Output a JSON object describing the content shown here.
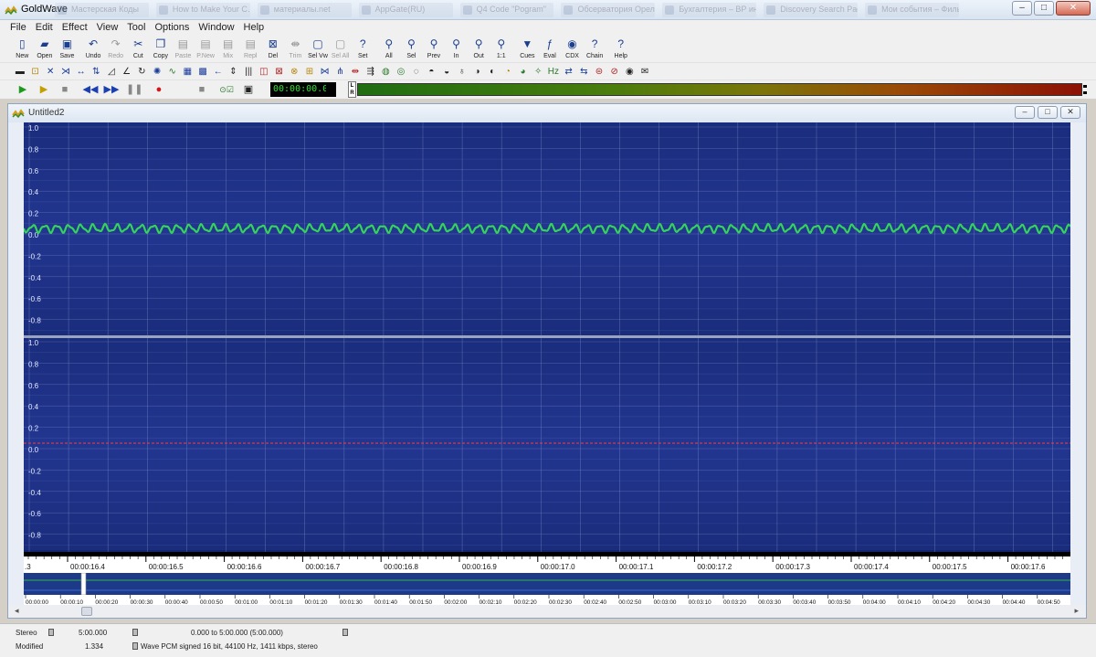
{
  "window": {
    "title": "GoldWave",
    "taskbar_ghosts": [
      "Мастерская Коды",
      "How to Make Your C…",
      "материалы.net",
      "AppGate(RU)",
      "Q4 Code \"Pogram\"",
      "Обсерватория Орел…",
      "Бухгалтерия – ВР инв…",
      "Discovery Search Page",
      "Мои события – Фильм…"
    ]
  },
  "menu": [
    "File",
    "Edit",
    "Effect",
    "View",
    "Tool",
    "Options",
    "Window",
    "Help"
  ],
  "toolbar": [
    {
      "label": "New",
      "icon": "new-file-icon",
      "glyph": "▯",
      "enabled": true
    },
    {
      "label": "Open",
      "icon": "folder-open-icon",
      "glyph": "▰",
      "enabled": true
    },
    {
      "label": "Save",
      "icon": "save-icon",
      "glyph": "▣",
      "enabled": true
    },
    {
      "sep": true
    },
    {
      "label": "Undo",
      "icon": "undo-icon",
      "glyph": "↶",
      "enabled": true
    },
    {
      "label": "Redo",
      "icon": "redo-icon",
      "glyph": "↷",
      "enabled": false
    },
    {
      "label": "Cut",
      "icon": "cut-icon",
      "glyph": "✂",
      "enabled": true
    },
    {
      "label": "Copy",
      "icon": "copy-icon",
      "glyph": "❐",
      "enabled": true
    },
    {
      "label": "Paste",
      "icon": "paste-icon",
      "glyph": "▤",
      "enabled": false
    },
    {
      "label": "P.New",
      "icon": "paste-new-icon",
      "glyph": "▤",
      "enabled": false
    },
    {
      "label": "Mix",
      "icon": "mix-icon",
      "glyph": "▤",
      "enabled": false
    },
    {
      "label": "Repl",
      "icon": "replace-icon",
      "glyph": "▤",
      "enabled": false
    },
    {
      "label": "Del",
      "icon": "delete-icon",
      "glyph": "⊠",
      "enabled": true
    },
    {
      "label": "Trim",
      "icon": "trim-icon",
      "glyph": "⇼",
      "enabled": false
    },
    {
      "label": "Sel Vw",
      "icon": "select-view-icon",
      "glyph": "▢",
      "enabled": true
    },
    {
      "label": "Sel All",
      "icon": "select-all-icon",
      "glyph": "▢",
      "enabled": false
    },
    {
      "label": "Set",
      "icon": "set-selection-icon",
      "glyph": "?",
      "enabled": true
    },
    {
      "sep": true
    },
    {
      "label": "All",
      "icon": "zoom-all-icon",
      "glyph": "⚲",
      "enabled": true
    },
    {
      "label": "Sel",
      "icon": "zoom-selection-icon",
      "glyph": "⚲",
      "enabled": true
    },
    {
      "label": "Prev",
      "icon": "zoom-previous-icon",
      "glyph": "⚲",
      "enabled": true
    },
    {
      "label": "In",
      "icon": "zoom-in-icon",
      "glyph": "⚲",
      "enabled": true
    },
    {
      "label": "Out",
      "icon": "zoom-out-icon",
      "glyph": "⚲",
      "enabled": true
    },
    {
      "label": "1:1",
      "icon": "zoom-1-1-icon",
      "glyph": "⚲",
      "enabled": true
    },
    {
      "sep": true
    },
    {
      "label": "Cues",
      "icon": "cues-icon",
      "glyph": "▼",
      "enabled": true
    },
    {
      "label": "Eval",
      "icon": "eval-icon",
      "glyph": "ƒ",
      "enabled": true
    },
    {
      "label": "CDX",
      "icon": "cd-icon",
      "glyph": "◉",
      "enabled": true
    },
    {
      "label": "Chain",
      "icon": "chain-icon",
      "glyph": "?",
      "enabled": true
    },
    {
      "sep": true
    },
    {
      "label": "Help",
      "icon": "help-icon",
      "glyph": "?",
      "enabled": true
    }
  ],
  "effects_toolbar": [
    {
      "icon": "silence-icon",
      "glyph": "▬",
      "tone": ""
    },
    {
      "icon": "auto-gain-icon",
      "glyph": "⊡",
      "tone": "c2"
    },
    {
      "icon": "bandpass-icon",
      "glyph": "✕",
      "tone": "c1"
    },
    {
      "icon": "compressor-icon",
      "glyph": "⋊",
      "tone": "c1"
    },
    {
      "icon": "doppler-icon",
      "glyph": "↔",
      "tone": "c1"
    },
    {
      "icon": "dynamics-icon",
      "glyph": "⇅",
      "tone": "c1"
    },
    {
      "icon": "echo-icon",
      "glyph": "◿",
      "tone": ""
    },
    {
      "icon": "envelope-icon",
      "glyph": "∠",
      "tone": ""
    },
    {
      "icon": "flanger-icon",
      "glyph": "↻",
      "tone": ""
    },
    {
      "icon": "invert-icon",
      "glyph": "✺",
      "tone": "c1"
    },
    {
      "icon": "mechanize-icon",
      "glyph": "∿",
      "tone": "c3"
    },
    {
      "icon": "noise-reduction-icon",
      "glyph": "▦",
      "tone": "c1"
    },
    {
      "icon": "offset-icon",
      "glyph": "▩",
      "tone": "c1"
    },
    {
      "icon": "pan-icon",
      "glyph": "←",
      "tone": "c1"
    },
    {
      "icon": "pitch-icon",
      "glyph": "⇕",
      "tone": ""
    },
    {
      "icon": "playback-rate-icon",
      "glyph": "|||",
      "tone": ""
    },
    {
      "icon": "reverse-icon",
      "glyph": "◫",
      "tone": "c4"
    },
    {
      "icon": "reverb-icon",
      "glyph": "⊠",
      "tone": "c4"
    },
    {
      "icon": "resample-icon",
      "glyph": "⊗",
      "tone": "c2"
    },
    {
      "icon": "shape-icon",
      "glyph": "⊞",
      "tone": "c2"
    },
    {
      "icon": "spatial-icon",
      "glyph": "⋈",
      "tone": "c1"
    },
    {
      "icon": "time-warp-icon",
      "glyph": "⋔",
      "tone": "c1"
    },
    {
      "icon": "volume-icon",
      "glyph": "⇹",
      "tone": "c4"
    },
    {
      "icon": "channel-mixer-icon",
      "glyph": "⇶",
      "tone": ""
    },
    {
      "icon": "click-filter-icon",
      "glyph": "◍",
      "tone": "c3"
    },
    {
      "icon": "equalizer-icon",
      "glyph": "◎",
      "tone": "c3"
    },
    {
      "icon": "fade-in-icon",
      "glyph": "◌",
      "tone": ""
    },
    {
      "icon": "fade-out-icon",
      "glyph": "◓",
      "tone": ""
    },
    {
      "icon": "filter-icon",
      "glyph": "◒",
      "tone": ""
    },
    {
      "icon": "interpolate-icon",
      "glyph": "♁",
      "tone": ""
    },
    {
      "icon": "lowpass-icon",
      "glyph": "◑",
      "tone": ""
    },
    {
      "icon": "maximize-icon",
      "glyph": "◐",
      "tone": ""
    },
    {
      "icon": "noise-icon",
      "glyph": "◔",
      "tone": "c2"
    },
    {
      "icon": "pop-filter-icon",
      "glyph": "◕",
      "tone": "c3"
    },
    {
      "icon": "spectrum-filter-icon",
      "glyph": "✧",
      "tone": "c3"
    },
    {
      "icon": "hz-filter-icon",
      "glyph": "Hz",
      "tone": "c3"
    },
    {
      "icon": "stereo-icon",
      "glyph": "⇄",
      "tone": "c1"
    },
    {
      "icon": "swap-channels-icon",
      "glyph": "⇆",
      "tone": "c1"
    },
    {
      "icon": "equalizer-graph-icon",
      "glyph": "⊜",
      "tone": "c4"
    },
    {
      "icon": "noise-gate-icon",
      "glyph": "⊘",
      "tone": "c4"
    },
    {
      "icon": "timer-icon",
      "glyph": "◉",
      "tone": ""
    },
    {
      "icon": "mail-icon",
      "glyph": "✉",
      "tone": ""
    }
  ],
  "transport": {
    "time": "00:00:00.0",
    "lr_label": "L\nR"
  },
  "document": {
    "title": "Untitled2",
    "wave_label_color": "#dfe5ff",
    "bg_color": "#14246e",
    "wave_color": "#34d35a",
    "center_line_color": "#ff3b3b",
    "channel_axis_labels": [
      "1.0",
      "0.8",
      "0.6",
      "0.4",
      "0.2",
      "0.0",
      "-0.2",
      "-0.4",
      "-0.6",
      "-0.8"
    ],
    "time_ticks": [
      "00:00:16.4",
      "00:00:16.5",
      "00:00:16.6",
      "00:00:16.7",
      "00:00:16.8",
      "00:00:16.9",
      "00:00:17.0",
      "00:00:17.1",
      "00:00:17.2",
      "00:00:17.3",
      "00:00:17.4",
      "00:00:17.5",
      "00:00:17.6"
    ],
    "ruler_start_fragment": ".3",
    "overview_ticks": [
      "00:00:00",
      "00:00:10",
      "00:00:20",
      "00:00:30",
      "00:00:40",
      "00:00:50",
      "00:01:00",
      "00:01:10",
      "00:01:20",
      "00:01:30",
      "00:01:40",
      "00:01:50",
      "00:02:00",
      "00:02:10",
      "00:02:20",
      "00:02:30",
      "00:02:40",
      "00:02:50",
      "00:03:00",
      "00:03:10",
      "00:03:20",
      "00:03:30",
      "00:03:40",
      "00:03:50",
      "00:04:00",
      "00:04:10",
      "00:04:20",
      "00:04:30",
      "00:04:40",
      "00:04:50"
    ]
  },
  "status": {
    "channels": "Stereo",
    "length": "5:00.000",
    "selection": "0.000 to 5:00.000 (5:00.000)",
    "state": "Modified",
    "value": "1.334",
    "format": "Wave PCM signed 16 bit, 44100 Hz, 1411 kbps, stereo"
  }
}
